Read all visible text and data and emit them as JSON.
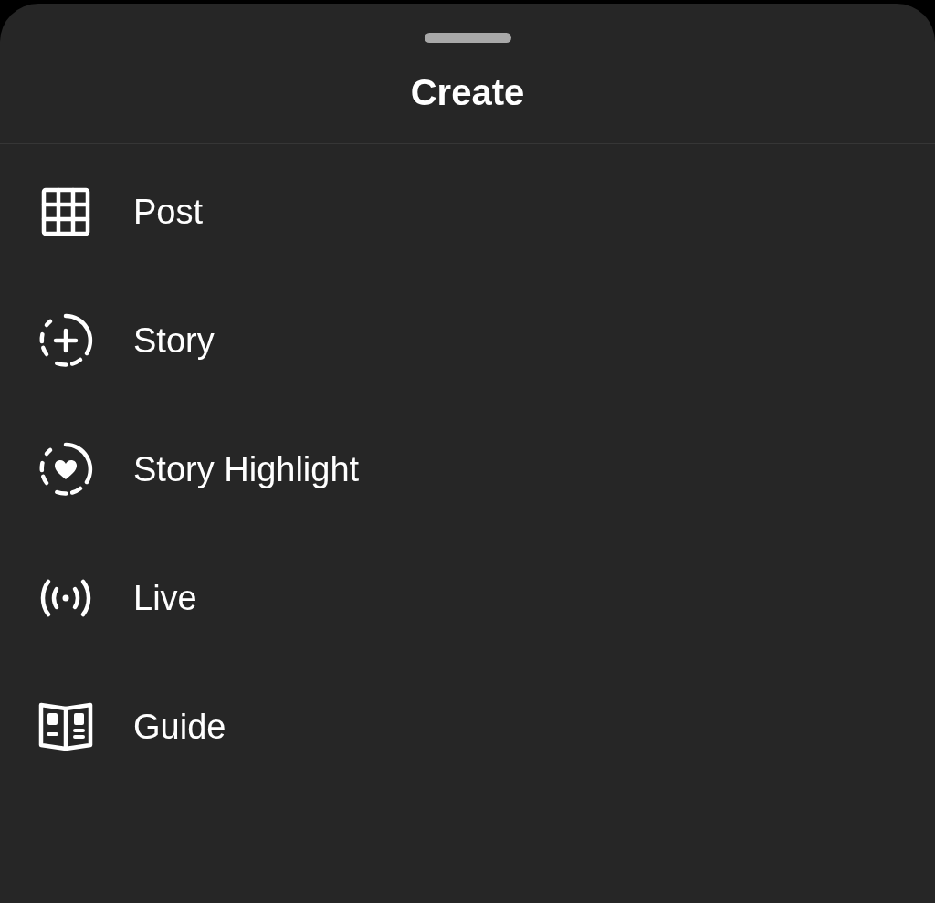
{
  "sheet": {
    "title": "Create"
  },
  "items": [
    {
      "kind": "post",
      "label": "Post"
    },
    {
      "kind": "story",
      "label": "Story"
    },
    {
      "kind": "highlight",
      "label": "Story Highlight"
    },
    {
      "kind": "live",
      "label": "Live"
    },
    {
      "kind": "guide",
      "label": "Guide"
    }
  ]
}
